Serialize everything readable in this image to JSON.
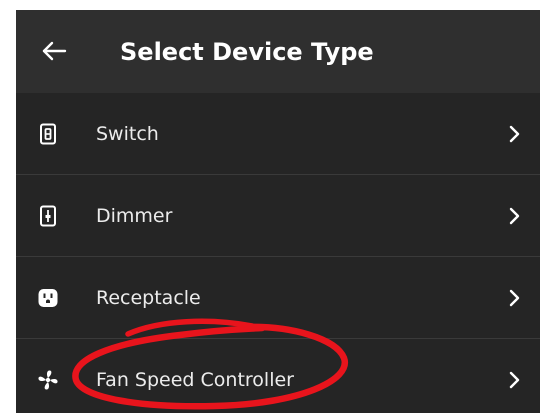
{
  "header": {
    "back_icon": "arrow-left-icon",
    "title": "Select Device Type"
  },
  "device_types": [
    {
      "label": "Switch",
      "icon": "switch-icon"
    },
    {
      "label": "Dimmer",
      "icon": "dimmer-icon"
    },
    {
      "label": "Receptacle",
      "icon": "receptacle-icon"
    },
    {
      "label": "Fan Speed Controller",
      "icon": "fan-icon"
    }
  ],
  "row_chevron_icon": "chevron-right-icon",
  "annotation": {
    "shape": "hand-drawn ellipse",
    "color": "#e8141c",
    "highlights": "Fan Speed Controller"
  },
  "colors": {
    "header_background": "#2f2f2f",
    "list_background": "#252525",
    "text": "#ececec"
  }
}
